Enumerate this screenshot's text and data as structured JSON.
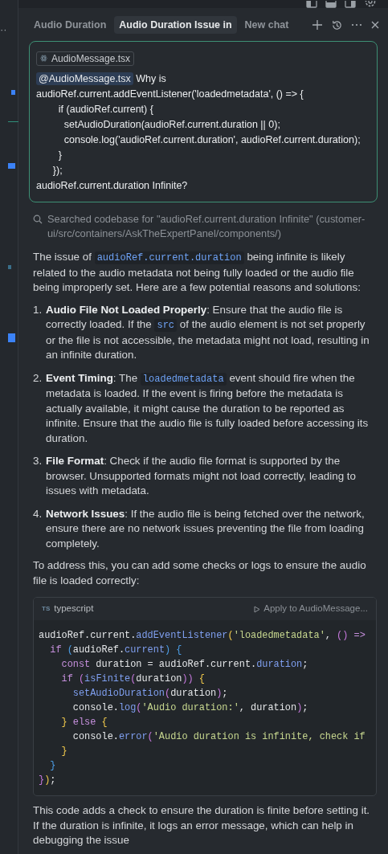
{
  "gutter_more": "··",
  "tabs": [
    {
      "label": "Audio Duration",
      "selected": false
    },
    {
      "label": "Audio Duration Issue in",
      "selected": true
    },
    {
      "label": "New chat",
      "selected": false
    }
  ],
  "user_message": {
    "attachment": "AudioMessage.tsx",
    "mention": "@AudioMessage.tsx",
    "text": " Why is\naudioRef.current.addEventListener('loadedmetadata', () => {\n        if (audioRef.current) {\n          setAudioDuration(audioRef.current.duration || 0);\n          console.log('audioRef.current.duration', audioRef.current.duration);\n        }\n      });\naudioRef.current.duration Infinite?"
  },
  "search_status": "Searched codebase for \"audioRef.current.duration Infinite\" (customer-ui/src/containers/AskTheExpertPanel/components/)",
  "answer": [
    {
      "kind": "paragraph",
      "segments": [
        {
          "kind": "text",
          "text": "The issue of "
        },
        {
          "kind": "code",
          "text": "audioRef.current.duration"
        },
        {
          "kind": "text",
          "text": " being infinite is likely related to the audio metadata not being fully loaded or the audio file being improperly set. Here are a few potential reasons and solutions:"
        }
      ]
    },
    {
      "kind": "list",
      "items": [
        {
          "number": "1.",
          "segments": [
            {
              "kind": "text",
              "text": "**Audio File Not Loaded Properly**: Ensure that the audio file is correctly loaded. If the "
            },
            {
              "kind": "code",
              "text": "src"
            },
            {
              "kind": "text",
              "text": " of the audio element is not set properly or the file is not accessible, the metadata might not load, resulting in an infinite duration."
            }
          ]
        },
        {
          "number": "2.",
          "segments": [
            {
              "kind": "text",
              "text": "**Event Timing**: The "
            },
            {
              "kind": "code",
              "text": "loadedmetadata"
            },
            {
              "kind": "text",
              "text": " event should fire when the metadata is loaded. If the event is firing before the metadata is actually available, it might cause the duration to be reported as infinite. Ensure that the audio file is fully loaded before accessing its duration."
            }
          ]
        },
        {
          "number": "3.",
          "segments": [
            {
              "kind": "text",
              "text": "**File Format**: Check if the audio file format is supported by the browser. Unsupported formats might not load correctly, leading to issues with metadata."
            }
          ]
        },
        {
          "number": "4.",
          "segments": [
            {
              "kind": "text",
              "text": "**Network Issues**: If the audio file is being fetched over the network, ensure there are no network issues preventing the file from loading completely."
            }
          ]
        }
      ]
    },
    {
      "kind": "paragraph",
      "segments": [
        {
          "kind": "text",
          "text": "To address this, you can add some checks or logs to ensure the audio file is loaded correctly:"
        }
      ]
    },
    {
      "kind": "code_block",
      "badge": "TS",
      "language": "typescript",
      "apply": "Apply to AudioMessage...",
      "lines": [
        [
          {
            "kind": "plain",
            "text": "audioRef.current."
          },
          {
            "kind": "function",
            "text": "addEventListener"
          },
          {
            "kind": "yellow",
            "text": "("
          },
          {
            "kind": "string",
            "text": "'loadedmetadata'"
          },
          {
            "kind": "plain",
            "text": ", "
          },
          {
            "kind": "purple",
            "text": "()"
          },
          {
            "kind": "keyword",
            "text": " =>"
          }
        ],
        [
          {
            "kind": "keyword",
            "text": "  if"
          },
          {
            "kind": "blue",
            "text": " ("
          },
          {
            "kind": "plain",
            "text": "audioRef."
          },
          {
            "kind": "function",
            "text": "current"
          },
          {
            "kind": "blue",
            "text": ")"
          },
          {
            "kind": "blue",
            "text": " {"
          }
        ],
        [
          {
            "kind": "keyword",
            "text": "    const"
          },
          {
            "kind": "plain",
            "text": " duration = audioRef.current."
          },
          {
            "kind": "function",
            "text": "duration"
          },
          {
            "kind": "plain",
            "text": ";"
          }
        ],
        [
          {
            "kind": "keyword",
            "text": "    if"
          },
          {
            "kind": "purple",
            "text": " ("
          },
          {
            "kind": "function",
            "text": "isFinite"
          },
          {
            "kind": "purple",
            "text": "("
          },
          {
            "kind": "plain",
            "text": "duration"
          },
          {
            "kind": "purple",
            "text": "))"
          },
          {
            "kind": "yellow",
            "text": " {"
          }
        ],
        [
          {
            "kind": "function",
            "text": "      setAudioDuration"
          },
          {
            "kind": "purple",
            "text": "("
          },
          {
            "kind": "plain",
            "text": "duration"
          },
          {
            "kind": "purple",
            "text": ")"
          },
          {
            "kind": "plain",
            "text": ";"
          }
        ],
        [
          {
            "kind": "plain",
            "text": "      console."
          },
          {
            "kind": "function",
            "text": "log"
          },
          {
            "kind": "purple",
            "text": "("
          },
          {
            "kind": "string",
            "text": "'Audio duration:'"
          },
          {
            "kind": "plain",
            "text": ", duration"
          },
          {
            "kind": "purple",
            "text": ")"
          },
          {
            "kind": "plain",
            "text": ";"
          }
        ],
        [
          {
            "kind": "yellow",
            "text": "    }"
          },
          {
            "kind": "keyword",
            "text": " else"
          },
          {
            "kind": "yellow",
            "text": " {"
          }
        ],
        [
          {
            "kind": "plain",
            "text": "      console."
          },
          {
            "kind": "function",
            "text": "error"
          },
          {
            "kind": "purple",
            "text": "("
          },
          {
            "kind": "string",
            "text": "'Audio duration is infinite, check if"
          }
        ],
        [
          {
            "kind": "yellow",
            "text": "    }"
          }
        ],
        [
          {
            "kind": "blue",
            "text": "  }"
          }
        ],
        [
          {
            "kind": "purple",
            "text": "}"
          },
          {
            "kind": "yellow",
            "text": ")"
          },
          {
            "kind": "plain",
            "text": ";"
          }
        ]
      ]
    },
    {
      "kind": "paragraph",
      "segments": [
        {
          "kind": "text",
          "text": "This code adds a check to ensure the duration is finite before setting it. If the duration is infinite, it logs an error message, which can help in debugging the issue"
        }
      ]
    }
  ]
}
